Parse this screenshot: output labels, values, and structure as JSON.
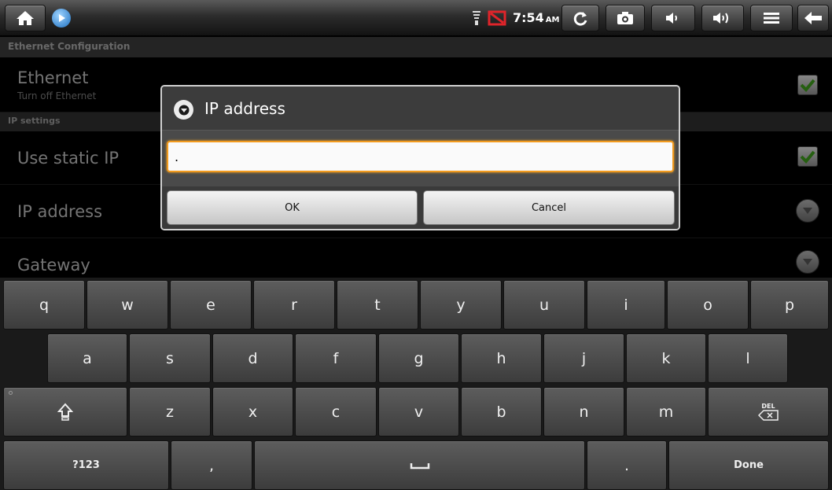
{
  "status_bar": {
    "time": "7:54",
    "ampm": "AM",
    "icons": [
      "home-icon",
      "play-circle-icon",
      "wifi-icon",
      "sd-card-blocked-icon",
      "refresh-icon",
      "camera-icon",
      "volume-down-icon",
      "volume-up-icon",
      "menu-icon",
      "back-icon"
    ]
  },
  "screen": {
    "title": "Ethernet Configuration",
    "ethernet": {
      "title": "Ethernet",
      "summary": "Turn off Ethernet",
      "checked": true
    },
    "section": "IP settings",
    "static_ip": {
      "title": "Use static IP",
      "checked": true
    },
    "ip_address": {
      "title": "IP address"
    },
    "gateway": {
      "title": "Gateway"
    }
  },
  "dialog": {
    "title": "IP address",
    "input_value": ".",
    "ok_label": "OK",
    "cancel_label": "Cancel"
  },
  "keyboard": {
    "row1": [
      "q",
      "w",
      "e",
      "r",
      "t",
      "y",
      "u",
      "i",
      "o",
      "p"
    ],
    "row2": [
      "a",
      "s",
      "d",
      "f",
      "g",
      "h",
      "j",
      "k",
      "l"
    ],
    "row3": [
      "z",
      "x",
      "c",
      "v",
      "b",
      "n",
      "m"
    ],
    "del_label": "DEL",
    "symbols_label": "?123",
    "comma_label": ",",
    "period_label": ".",
    "done_label": "Done"
  },
  "colors": {
    "input_focus": "#f19a1e",
    "check_green": "#3c9a1a",
    "sd_blocked": "#e0242a"
  }
}
